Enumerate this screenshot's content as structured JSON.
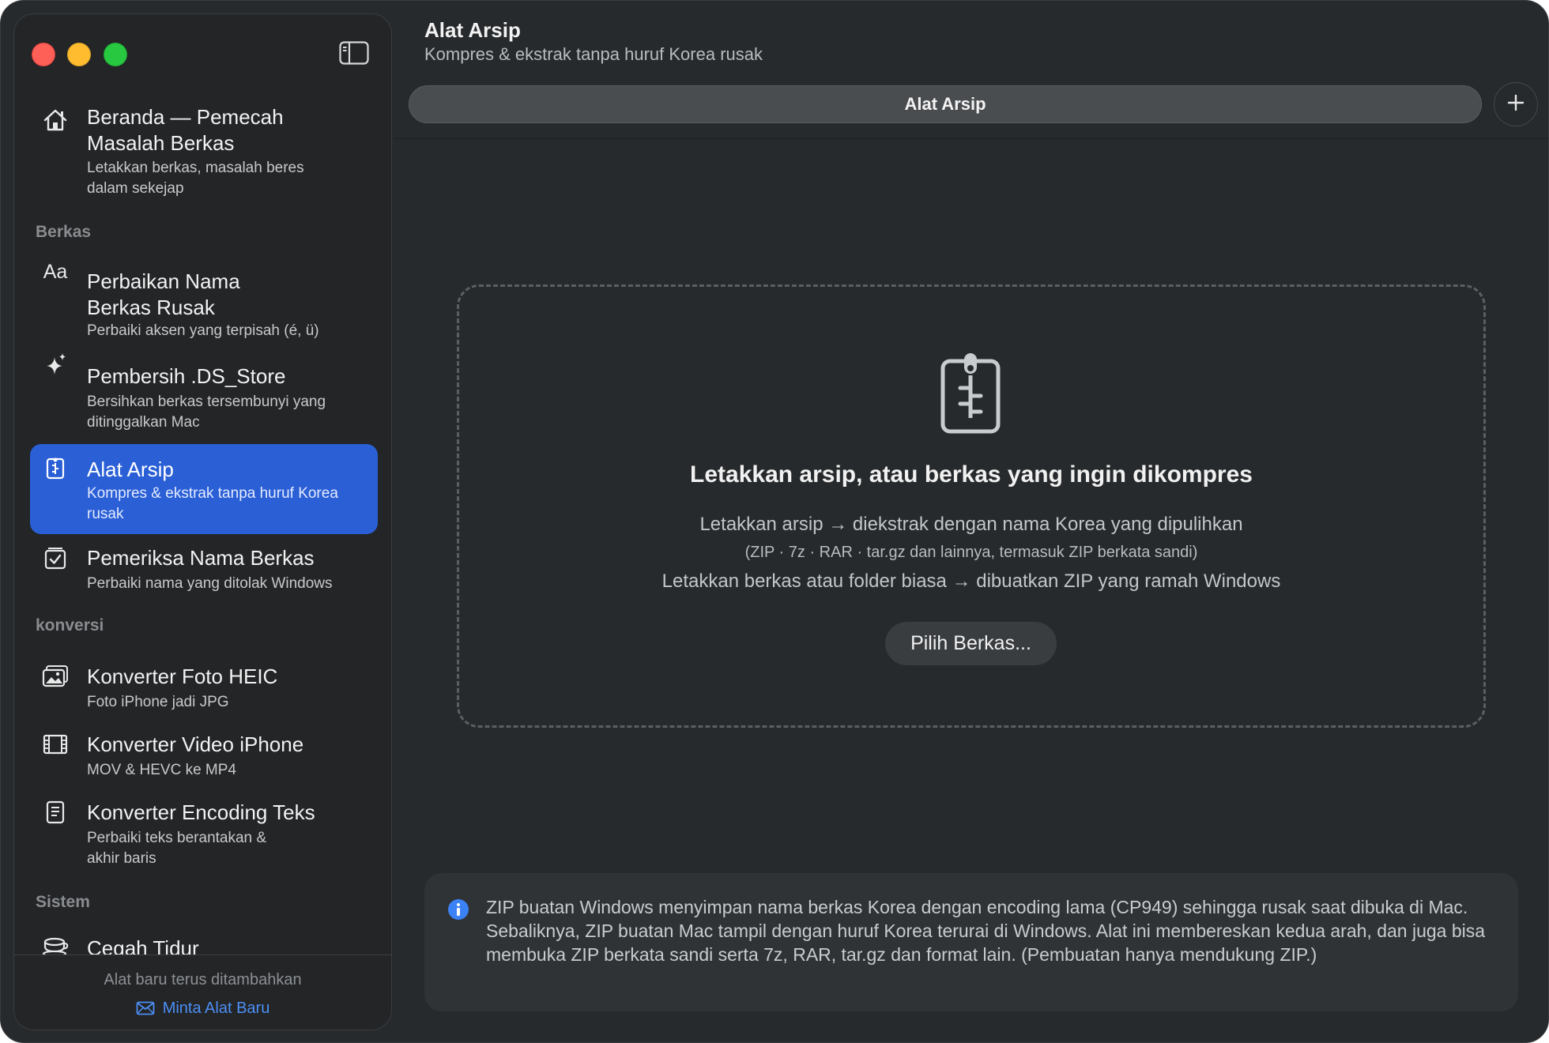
{
  "colors": {
    "window_bg": "#272a2c",
    "sidebar_bg": "#232527",
    "accent": "#2a5fd6",
    "link": "#4d8ff5",
    "info_icon": "#3b82f6"
  },
  "window": {
    "traffic_lights": [
      "close",
      "minimize",
      "zoom"
    ]
  },
  "sidebar": {
    "toggle_icon": "sidebar-toggle-icon",
    "home": {
      "title": "Beranda — Pemecah Masalah Berkas",
      "subtitle": "Letakkan berkas, masalah beres dalam sekejap",
      "icon": "house-icon"
    },
    "sections": [
      {
        "label": "Berkas",
        "items": [
          {
            "title": "Perbaikan Nama Berkas Rusak",
            "subtitle": "Perbaiki aksen yang terpisah (é, ü)",
            "icon": "text-aa-icon"
          },
          {
            "title": "Pembersih .DS_Store",
            "subtitle": "Bersihkan berkas tersembunyi yang ditinggalkan Mac",
            "icon": "sparkles-icon"
          },
          {
            "title": "Alat Arsip",
            "subtitle": "Kompres & ekstrak tanpa huruf Korea rusak",
            "icon": "zipper-document-icon",
            "active": true
          },
          {
            "title": "Pemeriksa Nama Berkas",
            "subtitle": "Perbaiki nama yang ditolak Windows",
            "icon": "checklist-icon"
          }
        ]
      },
      {
        "label": "konversi",
        "items": [
          {
            "title": "Konverter Foto HEIC",
            "subtitle": "Foto iPhone jadi JPG",
            "icon": "photos-icon"
          },
          {
            "title": "Konverter Video iPhone",
            "subtitle": "MOV & HEVC ke MP4",
            "icon": "film-icon"
          },
          {
            "title": "Konverter Encoding Teks",
            "subtitle": "Perbaiki teks berantakan & akhir baris",
            "icon": "text-document-icon"
          }
        ]
      },
      {
        "label": "Sistem",
        "items": [
          {
            "title": "Cegah Tidur",
            "subtitle": "",
            "icon": "coffee-cup-icon"
          }
        ]
      }
    ],
    "footer": {
      "note": "Alat baru terus ditambahkan",
      "link": "Minta Alat Baru",
      "link_icon": "envelope-icon"
    }
  },
  "main": {
    "title": "Alat Arsip",
    "subtitle": "Kompres & ekstrak tanpa huruf Korea rusak",
    "tab_label": "Alat Arsip",
    "add_tab_icon": "plus-icon",
    "drop_zone": {
      "icon": "zipper-document-icon",
      "heading": "Letakkan arsip, atau berkas yang ingin dikompres",
      "line1": "Letakkan arsip → diekstrak dengan nama Korea yang dipulihkan",
      "line2": "(ZIP · 7z · RAR · tar.gz dan lainnya, termasuk ZIP berkata sandi)",
      "line3": "Letakkan berkas atau folder biasa → dibuatkan ZIP yang ramah Windows",
      "button": "Pilih Berkas..."
    },
    "info": {
      "icon": "info-circle-icon",
      "text": "ZIP buatan Windows menyimpan nama berkas Korea dengan encoding lama (CP949) sehingga rusak saat dibuka di Mac. Sebaliknya, ZIP buatan Mac tampil dengan huruf Korea terurai di Windows. Alat ini membereskan kedua arah, dan juga bisa membuka ZIP berkata sandi serta 7z, RAR, tar.gz dan format lain. (Pembuatan hanya mendukung ZIP.)"
    }
  }
}
